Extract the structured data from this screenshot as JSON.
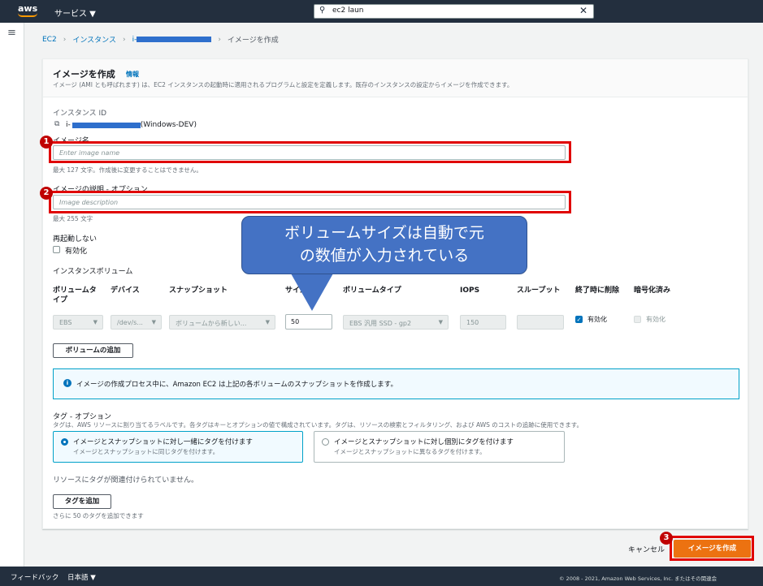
{
  "topnav": {
    "logo": "aws",
    "services_label": "サービス ▼",
    "search_value": "ec2 laun"
  },
  "breadcrumb": {
    "ec2": "EC2",
    "instances": "インスタンス",
    "instance_prefix": "i-",
    "current": "イメージを作成"
  },
  "header": {
    "title": "イメージを作成",
    "info_link": "情報",
    "description": "イメージ (AMI とも呼ばれます) は、EC2 インスタンスの起動時に適用されるプログラムと設定を定義します。既存のインスタンスの設定からイメージを作成できます。"
  },
  "instance_id": {
    "label": "インスタンス ID",
    "prefix": "i-",
    "suffix": "(Windows-DEV)"
  },
  "image_name": {
    "label": "イメージ名",
    "placeholder": "Enter image name",
    "hint": "最大 127 文字。作成後に変更することはできません。"
  },
  "image_description": {
    "label": "イメージの説明 - オプション",
    "placeholder": "Image description",
    "hint": "最大 255 文字"
  },
  "no_reboot": {
    "label": "再起動しない",
    "checkbox_label": "有効化"
  },
  "volumes": {
    "section_label": "インスタンスボリューム",
    "columns": {
      "volume_type_line1": "ボリュームタ",
      "volume_type_line2": "イプ",
      "device": "デバイス",
      "snapshot": "スナップショット",
      "size": "サイズ",
      "ebs_volume_type": "ボリュームタイプ",
      "iops": "IOPS",
      "throughput": "スループット",
      "delete_on_termination": "終了時に削除",
      "encrypted": "暗号化済み"
    },
    "row": {
      "volume_type": "EBS",
      "device": "/dev/s...",
      "snapshot": "ボリュームから新しい...",
      "size": "50",
      "ebs_volume_type": "EBS 汎用 SSD - gp2",
      "iops": "150",
      "throughput": "",
      "delete_on_termination_label": "有効化",
      "encrypted_label": "有効化"
    },
    "add_button": "ボリュームの追加"
  },
  "info_alert": "イメージの作成プロセス中に、Amazon EC2 は上記の各ボリュームのスナップショットを作成します。",
  "tags": {
    "label": "タグ - オプション",
    "description": "タグは、AWS リソースに割り当てるラベルです。各タグはキーとオプションの値で構成されています。タグは、リソースの検索とフィルタリング、および AWS のコストの追跡に使用できます。",
    "option1_title": "イメージとスナップショットに対し一緒にタグを付けます",
    "option1_desc": "イメージとスナップショットに同じタグを付けます。",
    "option2_title": "イメージとスナップショットに対し個別にタグを付けます",
    "option2_desc": "イメージとスナップショットに異なるタグを付けます。",
    "none_text": "リソースにタグが関連付けられていません。",
    "add_button": "タグを追加",
    "remaining": "さらに 50 のタグを追加できます"
  },
  "callout": {
    "line1": "ボリュームサイズは自動で元",
    "line2": "の数値が入力されている"
  },
  "badges": {
    "one": "1",
    "two": "2",
    "three": "3"
  },
  "actions": {
    "cancel": "キャンセル",
    "create": "イメージを作成"
  },
  "footer": {
    "feedback": "フィードバック",
    "language": "日本語 ▼",
    "copyright": "© 2008 - 2021, Amazon Web Services, Inc. またはその関連会"
  },
  "colors": {
    "primary_button": "#ec7211",
    "annotation_red": "#e00000",
    "callout_blue": "#4472c4",
    "link": "#0073bb"
  }
}
